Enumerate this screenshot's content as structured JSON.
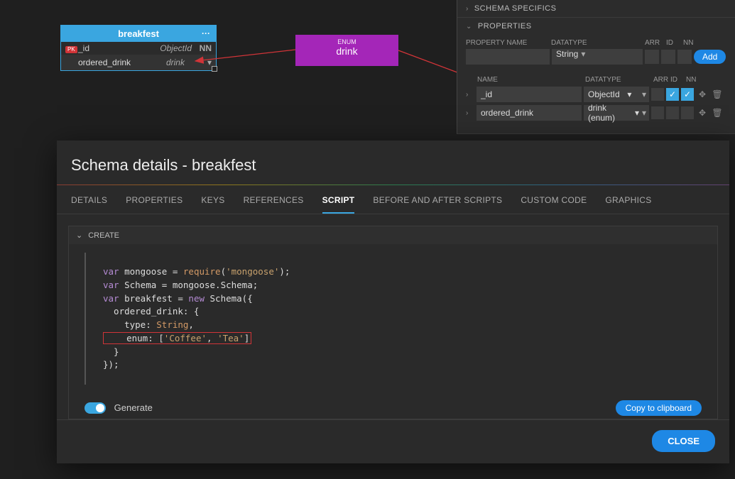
{
  "entity": {
    "name": "breakfest",
    "rows": [
      {
        "key": true,
        "name": "_id",
        "type": "ObjectId",
        "nn": "NN"
      },
      {
        "key": false,
        "name": "ordered_drink",
        "type": "drink",
        "nn": ""
      }
    ]
  },
  "enum_box": {
    "label": "ENUM",
    "name": "drink"
  },
  "sidebar": {
    "sections": {
      "specifics": "SCHEMA SPECIFICS",
      "properties": "PROPERTIES"
    },
    "new": {
      "labels": {
        "name": "PROPERTY NAME",
        "datatype": "DATATYPE",
        "arr": "ARR",
        "id": "ID",
        "nn": "NN"
      },
      "datatype": "String",
      "add": "Add"
    },
    "list": {
      "labels": {
        "name": "NAME",
        "datatype": "DATATYPE",
        "arr": "ARR",
        "id": "ID",
        "nn": "NN"
      },
      "rows": [
        {
          "name": "_id",
          "datatype": "ObjectId",
          "arr": false,
          "id": true,
          "nn": true
        },
        {
          "name": "ordered_drink",
          "datatype": "drink (enum)",
          "arr": false,
          "id": false,
          "nn": false
        }
      ]
    }
  },
  "modal": {
    "title": "Schema details - breakfest",
    "tabs": [
      "DETAILS",
      "PROPERTIES",
      "KEYS",
      "REFERENCES",
      "SCRIPT",
      "BEFORE AND AFTER SCRIPTS",
      "CUSTOM CODE",
      "GRAPHICS"
    ],
    "active_tab": "SCRIPT",
    "create_label": "CREATE",
    "code": {
      "l1a": "var",
      "l1b": " mongoose = ",
      "l1c": "require",
      "l1d": "(",
      "l1e": "'mongoose'",
      "l1f": ");",
      "l2a": "var",
      "l2b": " Schema = mongoose.Schema;",
      "l3a": "var",
      "l3b": " breakfest = ",
      "l3c": "new",
      "l3d": " Schema({",
      "l4": "  ordered_drink: {",
      "l5a": "    type: ",
      "l5b": "String",
      "l5c": ",",
      "l6a": "    enum: [",
      "l6b": "'Coffee'",
      "l6c": ", ",
      "l6d": "'Tea'",
      "l6e": "]",
      "l7": "  }",
      "l8": "});"
    },
    "generate": "Generate",
    "copy": "Copy to clipboard",
    "close": "CLOSE"
  }
}
